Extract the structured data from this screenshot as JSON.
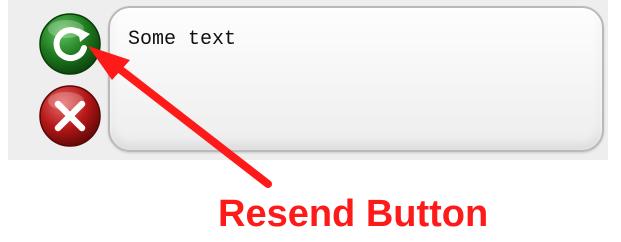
{
  "message": {
    "text": "Some text"
  },
  "buttons": {
    "resend_icon": "refresh-icon",
    "cancel_icon": "close-icon"
  },
  "annotation": {
    "label": "Resend Button",
    "color": "#ff1a1a"
  },
  "colors": {
    "resend_green": "#1e7a1e",
    "cancel_red": "#b51717",
    "panel_bg": "#eeeeee"
  }
}
